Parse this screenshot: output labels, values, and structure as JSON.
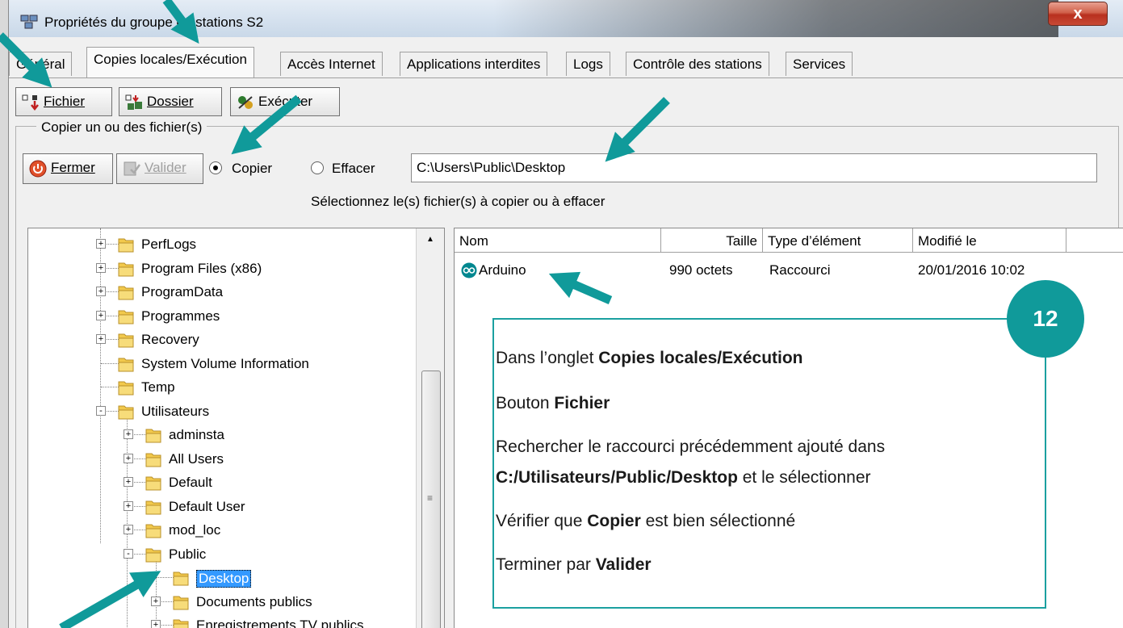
{
  "window": {
    "title": "Propriétés du groupe de stations S2",
    "close_label": "x"
  },
  "tabs": [
    {
      "label": "Général"
    },
    {
      "label": "Copies locales/Exécution",
      "active": true
    },
    {
      "label": "Accès Internet"
    },
    {
      "label": "Applications interdites"
    },
    {
      "label": "Logs"
    },
    {
      "label": "Contrôle des stations"
    },
    {
      "label": "Services"
    }
  ],
  "toolbar": {
    "fichier": "Fichier",
    "dossier": "Dossier",
    "executer": "Exécuter"
  },
  "group": {
    "label": "Copier un ou des fichier(s)",
    "fermer": "Fermer",
    "valider": "Valider",
    "copier": "Copier",
    "effacer": "Effacer",
    "selected_option": "Copier",
    "path_value": "C:\\Users\\Public\\Desktop",
    "instruction": "Sélectionnez le(s) fichier(s) à copier ou à effacer"
  },
  "tree": {
    "items": [
      {
        "label": "PerfLogs",
        "depth": 0,
        "expander": "+"
      },
      {
        "label": "Program Files (x86)",
        "depth": 0,
        "expander": "+"
      },
      {
        "label": "ProgramData",
        "depth": 0,
        "expander": "+"
      },
      {
        "label": "Programmes",
        "depth": 0,
        "expander": "+"
      },
      {
        "label": "Recovery",
        "depth": 0,
        "expander": "+"
      },
      {
        "label": "System Volume Information",
        "depth": 0,
        "expander": ""
      },
      {
        "label": "Temp",
        "depth": 0,
        "expander": ""
      },
      {
        "label": "Utilisateurs",
        "depth": 0,
        "expander": "-"
      },
      {
        "label": "adminsta",
        "depth": 1,
        "expander": "+"
      },
      {
        "label": "All Users",
        "depth": 1,
        "expander": "+"
      },
      {
        "label": "Default",
        "depth": 1,
        "expander": "+"
      },
      {
        "label": "Default User",
        "depth": 1,
        "expander": "+"
      },
      {
        "label": "mod_loc",
        "depth": 1,
        "expander": "+"
      },
      {
        "label": "Public",
        "depth": 1,
        "expander": "-"
      },
      {
        "label": "Desktop",
        "depth": 2,
        "expander": "",
        "selected": true
      },
      {
        "label": "Documents publics",
        "depth": 2,
        "expander": "+"
      },
      {
        "label": "Enregistrements TV publics",
        "depth": 2,
        "expander": "+"
      }
    ]
  },
  "file_list": {
    "columns": [
      "Nom",
      "Taille",
      "Type d’élément",
      "Modifié le"
    ],
    "rows": [
      {
        "name": "Arduino",
        "size": "990 octets",
        "type": "Raccourci",
        "modified": "20/01/2016 10:02"
      }
    ]
  },
  "callout": {
    "badge": "12",
    "line1_prefix": "Dans l’onglet ",
    "line1_bold": "Copies locales/Exécution",
    "line2_prefix": "Bouton ",
    "line2_bold": "Fichier",
    "line3": "Rechercher le raccourci précédemment ajouté dans",
    "line4_bold": "C:/Utilisateurs/Public/Desktop",
    "line4_suffix": " et le sélectionner",
    "line5_prefix": "Vérifier que ",
    "line5_bold": "Copier",
    "line5_suffix": " est bien sélectionné",
    "line6_prefix": "Terminer par ",
    "line6_bold": "Valider"
  },
  "colors": {
    "accent": "#109a9a",
    "selection": "#3399ff",
    "folder": "#f2c94c"
  }
}
